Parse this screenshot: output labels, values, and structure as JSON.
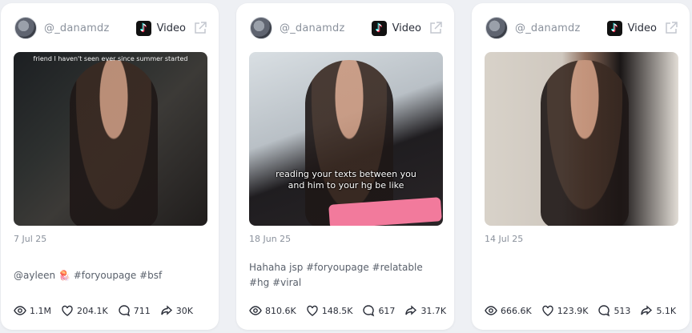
{
  "cards": [
    {
      "handle": "@_danamdz",
      "type_label": "Video",
      "overlay_text": "friend I haven't seen ever since summer started",
      "date": "7 Jul 25",
      "caption": "@ayleen 🪼 #foryoupage #bsf",
      "views": "1.1M",
      "likes": "204.1K",
      "comments": "711",
      "shares": "30K"
    },
    {
      "handle": "@_danamdz",
      "type_label": "Video",
      "overlay_text": "reading your texts between you and him to your hg be like",
      "date": "18 Jun 25",
      "caption": "Hahaha jsp #foryoupage #relatable #hg #viral",
      "views": "810.6K",
      "likes": "148.5K",
      "comments": "617",
      "shares": "31.7K"
    },
    {
      "handle": "@_danamdz",
      "type_label": "Video",
      "date": "14 Jul 25",
      "caption": "",
      "views": "666.6K",
      "likes": "123.9K",
      "comments": "513",
      "shares": "5.1K"
    }
  ],
  "icons": {
    "platform": "tiktok-icon",
    "external": "external-link-icon",
    "views": "eye-icon",
    "likes": "heart-icon",
    "comments": "comment-icon",
    "shares": "share-icon"
  }
}
